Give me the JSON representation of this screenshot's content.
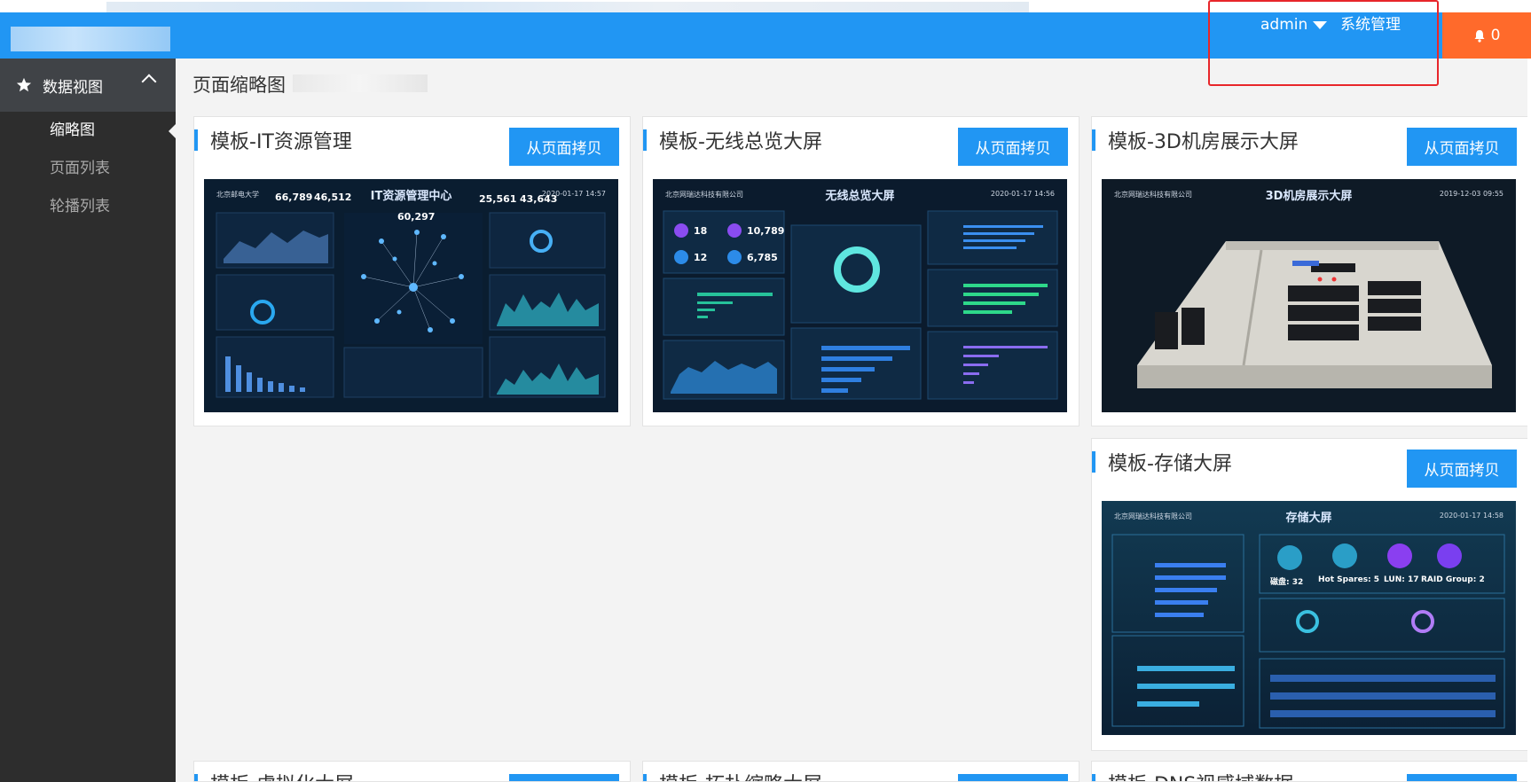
{
  "header": {
    "user": "admin",
    "system_menu": "系统管理",
    "notification_count": "0",
    "colors": {
      "bar": "#2196f3",
      "alert": "#ff6a2b"
    }
  },
  "sidebar": {
    "group": "数据视图",
    "items": [
      {
        "label": "缩略图",
        "active": true
      },
      {
        "label": "页面列表",
        "active": false
      },
      {
        "label": "轮播列表",
        "active": false
      }
    ]
  },
  "main": {
    "title": "页面缩略图",
    "copy_label": "从页面拷贝",
    "cards": [
      {
        "title": "模板-IT资源管理",
        "thumb_title": "IT资源管理中心",
        "thumb_company": "北京邮电大学",
        "thumb_date": "2020-01-17 14:57",
        "stats": [
          "66,789",
          "46,512",
          "25,561",
          "43,643",
          "60,297"
        ]
      },
      {
        "title": "模板-无线总览大屏",
        "thumb_title": "无线总览大屏",
        "thumb_company": "北京网瑞达科技有限公司",
        "thumb_date": "2020-01-17 14:56",
        "stats": [
          "18",
          "10,789",
          "12",
          "6,785"
        ]
      },
      {
        "title": "模板-3D机房展示大屏",
        "thumb_title": "3D机房展示大屏",
        "thumb_company": "北京网瑞达科技有限公司",
        "thumb_date": "2019-12-03 09:55"
      },
      {
        "title": "模板-存储大屏",
        "thumb_title": "存储大屏",
        "thumb_company": "北京网瑞达科技有限公司",
        "thumb_date": "2020-01-17 14:58",
        "stats": [
          {
            "label": "磁盘:",
            "value": "32"
          },
          {
            "label": "Hot Spares:",
            "value": "5"
          },
          {
            "label": "LUN:",
            "value": "17"
          },
          {
            "label": "RAID Group:",
            "value": "2"
          }
        ]
      }
    ],
    "partial_cards": [
      "模板-虚拟化大屏",
      "模板-拓扑缩略大屏",
      "模板-DNS视感域数据"
    ]
  }
}
